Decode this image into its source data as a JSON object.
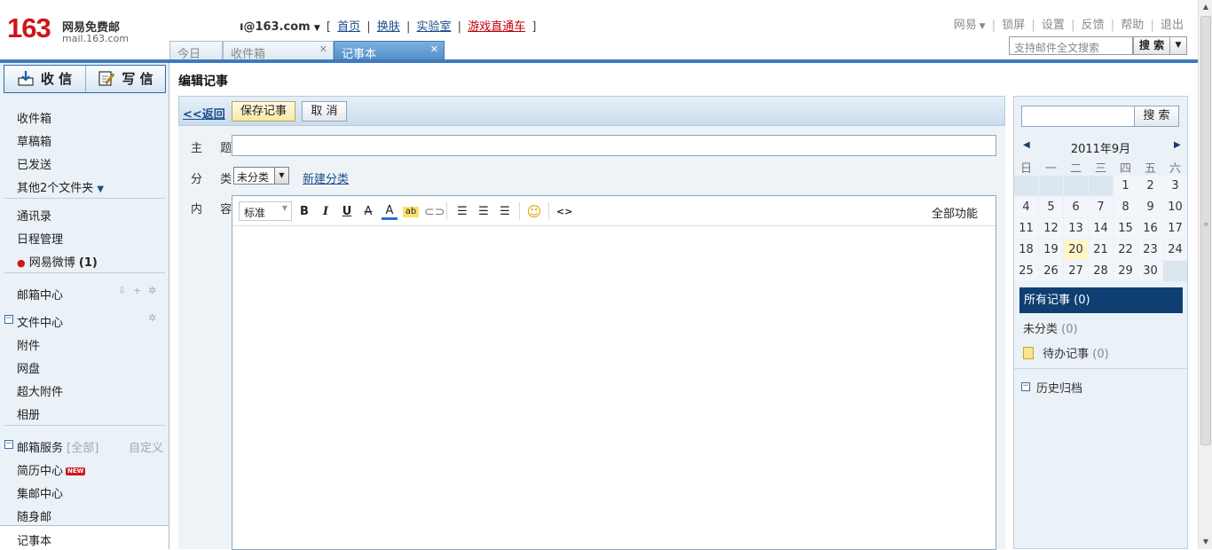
{
  "header": {
    "logo_num": "163",
    "logo_cn": "网易免费邮",
    "logo_url": "mail.163.com",
    "account": "ı@163.com",
    "links": [
      "首页",
      "换肤",
      "实验室",
      "游戏直通车"
    ],
    "top_links": [
      "网易",
      "锁屏",
      "设置",
      "反馈",
      "帮助",
      "退出"
    ],
    "search_placeholder": "支持邮件全文搜索",
    "search_button": "搜 索"
  },
  "tabs": [
    {
      "label": "今日"
    },
    {
      "label": "收件箱"
    },
    {
      "label": "记事本"
    }
  ],
  "sidebar": {
    "receive": "收 信",
    "compose": "写 信",
    "folders": [
      "收件箱",
      "草稿箱",
      "已发送",
      "其他2个文件夹"
    ],
    "tools": [
      "通讯录",
      "日程管理",
      "网易微博"
    ],
    "weibo_count": "(1)",
    "mailbox_center": "邮箱中心",
    "file_center": "文件中心",
    "file_items": [
      "附件",
      "网盘",
      "超大附件",
      "相册"
    ],
    "services": "邮箱服务",
    "services_all": "[全部]",
    "customize": "自定义",
    "service_items": [
      "简历中心",
      "集邮中心",
      "随身邮"
    ],
    "new_badge": "NEW",
    "selected": "记事本"
  },
  "main": {
    "title": "编辑记事",
    "back": "<<返回",
    "save": "保存记事",
    "cancel": "取 消",
    "subject_label": "主 题",
    "category_label": "分 类",
    "category_value": "未分类",
    "new_category": "新建分类",
    "content_label": "内 容",
    "editor": {
      "style_select": "标准",
      "all_functions": "全部功能"
    }
  },
  "right": {
    "search_button": "搜 索",
    "calendar": {
      "month": "2011年9月",
      "weekdays": [
        "日",
        "一",
        "二",
        "三",
        "四",
        "五",
        "六"
      ],
      "leading_blanks": 4,
      "days": 30,
      "today": 20
    },
    "all_notes": "所有记事 (0)",
    "uncategorized": "未分类",
    "uncategorized_count": "(0)",
    "todo": "待办记事",
    "todo_count": "(0)",
    "archive": "历史归档"
  }
}
